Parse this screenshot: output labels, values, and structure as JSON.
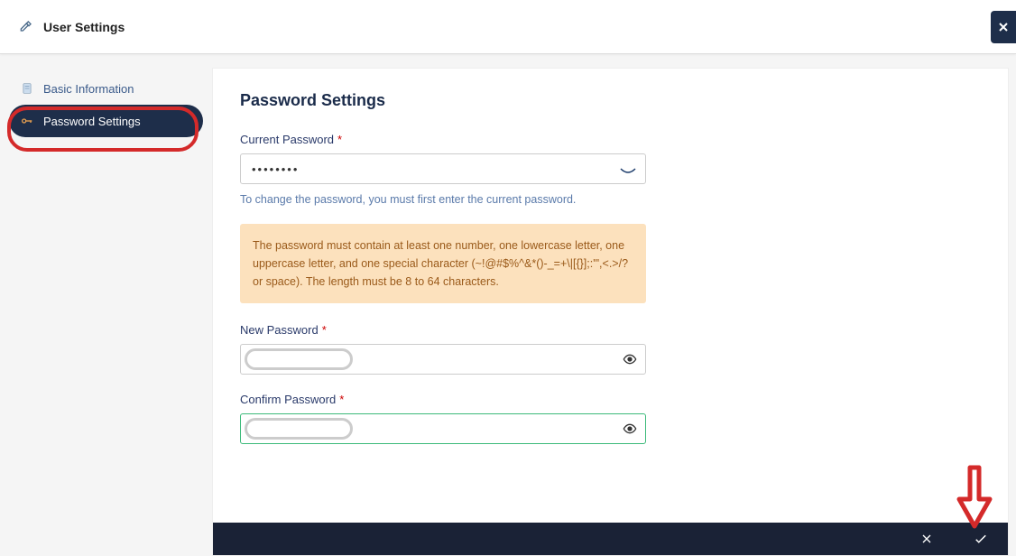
{
  "header": {
    "title": "User Settings"
  },
  "sidebar": {
    "items": [
      {
        "label": "Basic Information"
      },
      {
        "label": "Password Settings"
      }
    ]
  },
  "main": {
    "title": "Password Settings",
    "current_password": {
      "label": "Current Password",
      "value": "••••••••",
      "helper": "To change the password, you must first enter the current password."
    },
    "info_box": "The password must contain at least one number, one lowercase letter, one uppercase letter, and one special character (~!@#$%^&*()-_=+\\|[{}];:'\",<.>/? or space). The length must be 8 to 64 characters.",
    "new_password": {
      "label": "New Password",
      "value": ""
    },
    "confirm_password": {
      "label": "Confirm Password",
      "value": ""
    }
  }
}
